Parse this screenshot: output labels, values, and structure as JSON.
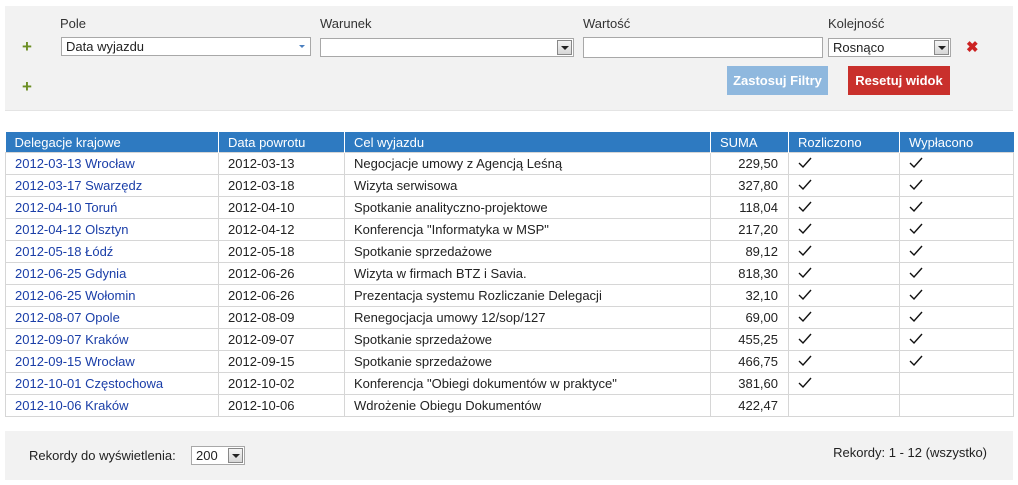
{
  "filter": {
    "headers": {
      "field": "Pole",
      "condition": "Warunek",
      "value": "Wartość",
      "order": "Kolejność"
    },
    "field_value": "Data wyjazdu",
    "condition_value": "",
    "value_input": "",
    "order_value": "Rosnąco",
    "apply_label": "Zastosuj Filtry",
    "reset_label": "Resetuj widok",
    "add_icon": "plus-icon",
    "remove_icon": "x-icon"
  },
  "table": {
    "columns": [
      "Delegacje krajowe",
      "Data powrotu",
      "Cel wyjazdu",
      "SUMA",
      "Rozliczono",
      "Wypłacono"
    ],
    "rows": [
      {
        "delegation": "2012-03-13 Wrocław",
        "return": "2012-03-13",
        "purpose": "Negocjacje umowy z Agencją Leśną",
        "sum": "229,50",
        "settled": true,
        "paid": true
      },
      {
        "delegation": "2012-03-17 Swarzędz",
        "return": "2012-03-18",
        "purpose": "Wizyta serwisowa",
        "sum": "327,80",
        "settled": true,
        "paid": true
      },
      {
        "delegation": "2012-04-10 Toruń",
        "return": "2012-04-10",
        "purpose": "Spotkanie analityczno-projektowe",
        "sum": "118,04",
        "settled": true,
        "paid": true
      },
      {
        "delegation": "2012-04-12 Olsztyn",
        "return": "2012-04-12",
        "purpose": "Konferencja \"Informatyka w MSP\"",
        "sum": "217,20",
        "settled": true,
        "paid": true
      },
      {
        "delegation": "2012-05-18 Łódź",
        "return": "2012-05-18",
        "purpose": "Spotkanie sprzedażowe",
        "sum": "89,12",
        "settled": true,
        "paid": true
      },
      {
        "delegation": "2012-06-25 Gdynia",
        "return": "2012-06-26",
        "purpose": "Wizyta w firmach BTZ i Savia.",
        "sum": "818,30",
        "settled": true,
        "paid": true
      },
      {
        "delegation": "2012-06-25 Wołomin",
        "return": "2012-06-26",
        "purpose": "Prezentacja systemu Rozliczanie Delegacji",
        "sum": "32,10",
        "settled": true,
        "paid": true
      },
      {
        "delegation": "2012-08-07 Opole",
        "return": "2012-08-09",
        "purpose": "Renegocjacja umowy 12/sop/127",
        "sum": "69,00",
        "settled": true,
        "paid": true
      },
      {
        "delegation": "2012-09-07 Kraków",
        "return": "2012-09-07",
        "purpose": "Spotkanie sprzedażowe",
        "sum": "455,25",
        "settled": true,
        "paid": true
      },
      {
        "delegation": "2012-09-15 Wrocław",
        "return": "2012-09-15",
        "purpose": "Spotkanie sprzedażowe",
        "sum": "466,75",
        "settled": true,
        "paid": true
      },
      {
        "delegation": "2012-10-01 Częstochowa",
        "return": "2012-10-02",
        "purpose": "Konferencja \"Obiegi dokumentów w praktyce\"",
        "sum": "381,60",
        "settled": true,
        "paid": false
      },
      {
        "delegation": "2012-10-06 Kraków",
        "return": "2012-10-06",
        "purpose": "Wdrożenie Obiegu Dokumentów",
        "sum": "422,47",
        "settled": false,
        "paid": false
      }
    ]
  },
  "footer": {
    "records_label": "Rekordy do wyświetlenia:",
    "records_value": "200",
    "records_info": "Rekordy: 1 - 12 (wszystko)"
  },
  "colors": {
    "header_blue": "#2e7ac1",
    "link_blue": "#1a3ea8",
    "apply_button": "#8fb8de",
    "reset_button": "#c9302c",
    "add_green": "#6b8e23",
    "remove_red": "#cc2222"
  }
}
